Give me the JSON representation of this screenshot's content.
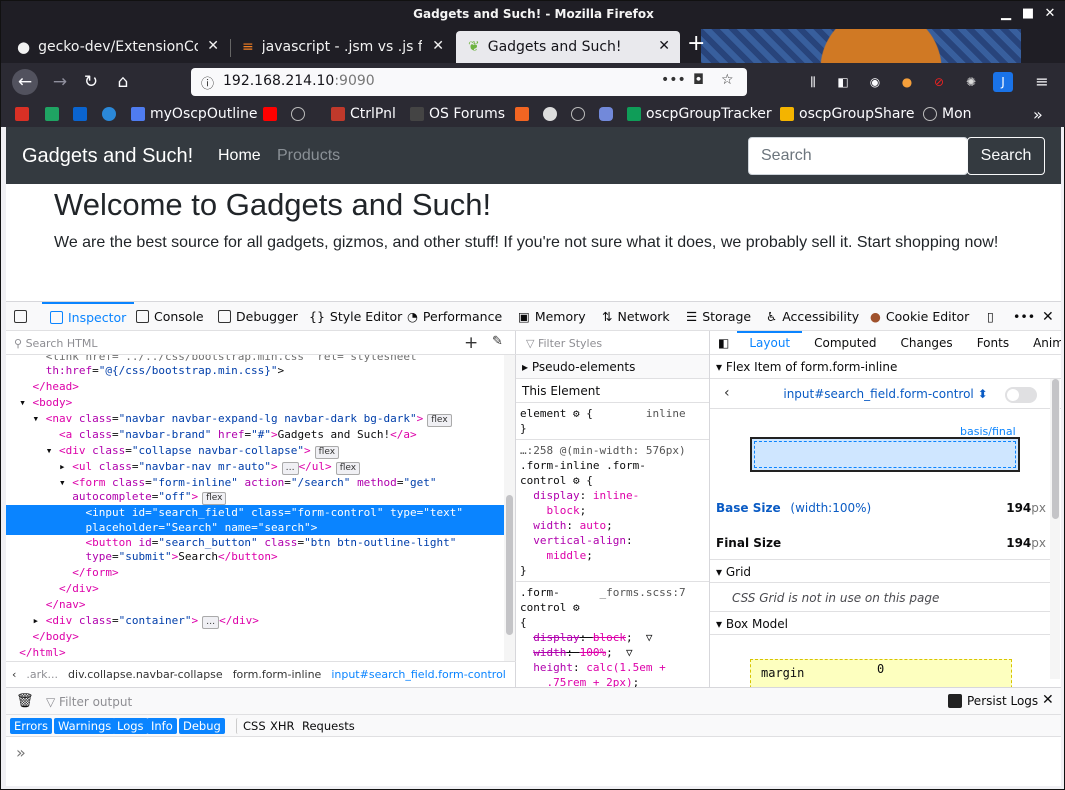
{
  "window": {
    "title": "Gadgets and Such! - Mozilla Firefox"
  },
  "tabs": [
    {
      "label": "gecko-dev/ExtensionCon",
      "icon": "github-icon"
    },
    {
      "label": "javascript - .jsm vs .js file",
      "icon": "stackoverflow-icon"
    },
    {
      "label": "Gadgets and Such!",
      "icon": "leaf-icon"
    }
  ],
  "urlbar": {
    "host": "192.168.214.10",
    "port": ":9090"
  },
  "bookmarks": [
    {
      "label": "",
      "icon": "gmail-icon",
      "color": "#d93025"
    },
    {
      "label": "",
      "icon": "drive-icon",
      "color": "#1fa463"
    },
    {
      "label": "",
      "icon": "outlook-icon",
      "color": "#0a64d0"
    },
    {
      "label": "",
      "icon": "onedrive-icon",
      "color": "#2b88d8"
    },
    {
      "label": "myOscpOutline",
      "icon": "doc-icon",
      "color": "#4f7cf0"
    },
    {
      "label": "",
      "icon": "youtube-icon",
      "color": "#ff0000"
    },
    {
      "label": "",
      "icon": "globe-icon",
      "color": "#bbbbbb"
    },
    {
      "label": "CtrlPnl",
      "icon": "ctrlpnl-icon",
      "color": "#c0392b"
    },
    {
      "label": "OS Forums",
      "icon": "forum-icon",
      "color": "#444444"
    },
    {
      "label": "",
      "icon": "bolt-icon",
      "color": "#f26522"
    },
    {
      "label": "",
      "icon": "github-icon",
      "color": "#dddddd"
    },
    {
      "label": "",
      "icon": "globe-icon",
      "color": "#bbbbbb"
    },
    {
      "label": "",
      "icon": "discord-icon",
      "color": "#7289da"
    },
    {
      "label": "oscpGroupTracker",
      "icon": "sheet-icon",
      "color": "#0f9d58"
    },
    {
      "label": "oscpGroupShare",
      "icon": "drive-icon",
      "color": "#f4b400"
    },
    {
      "label": "Mon",
      "icon": "globe-icon",
      "color": "#bbbbbb"
    }
  ],
  "site": {
    "brand": "Gadgets and Such!",
    "nav": [
      "Home",
      "Products"
    ],
    "search_placeholder": "Search",
    "search_button": "Search",
    "heading": "Welcome to Gadgets and Such!",
    "lead": "We are the best source for all gadgets, gizmos, and other stuff! If you're not sure what it does, we probably sell it. Start shopping now!"
  },
  "devtools": {
    "tabs": [
      "Inspector",
      "Console",
      "Debugger",
      "Style Editor",
      "Performance",
      "Memory",
      "Network",
      "Storage",
      "Accessibility",
      "Cookie Editor"
    ],
    "search_placeholder": "Search HTML",
    "breadcrumb": [
      ".ark...",
      "div.collapse.navbar-collapse",
      "form.form-inline",
      "input#search_field.form-control"
    ],
    "rules": {
      "filter_placeholder": "Filter Styles",
      "pseudo": "Pseudo-elements",
      "this_element": "This Element",
      "inline_label": "inline",
      "media_source": "…:258 @(min-width: 576px)",
      "forms_source": "_forms.scss:7"
    },
    "layout": {
      "tabs": [
        "Layout",
        "Computed",
        "Changes",
        "Fonts",
        "Animat"
      ],
      "flex_item_title": "Flex Item of form.form-inline",
      "selector": "input#search_field.form-control",
      "basis_label": "basis/final",
      "base_size_label": "Base Size",
      "base_size_note": "(width:100%)",
      "base_size_value": "194",
      "final_size_label": "Final Size",
      "final_size_value": "194",
      "unit": "px",
      "grid_title": "Grid",
      "grid_note": "CSS Grid is not in use on this page",
      "box_model_title": "Box Model",
      "margin_label": "margin",
      "margin_value": "0"
    },
    "console": {
      "filter_placeholder": "Filter output",
      "persist_logs": "Persist Logs",
      "filters": [
        "Errors",
        "Warnings",
        "Logs",
        "Info",
        "Debug",
        "CSS",
        "XHR",
        "Requests"
      ]
    }
  }
}
